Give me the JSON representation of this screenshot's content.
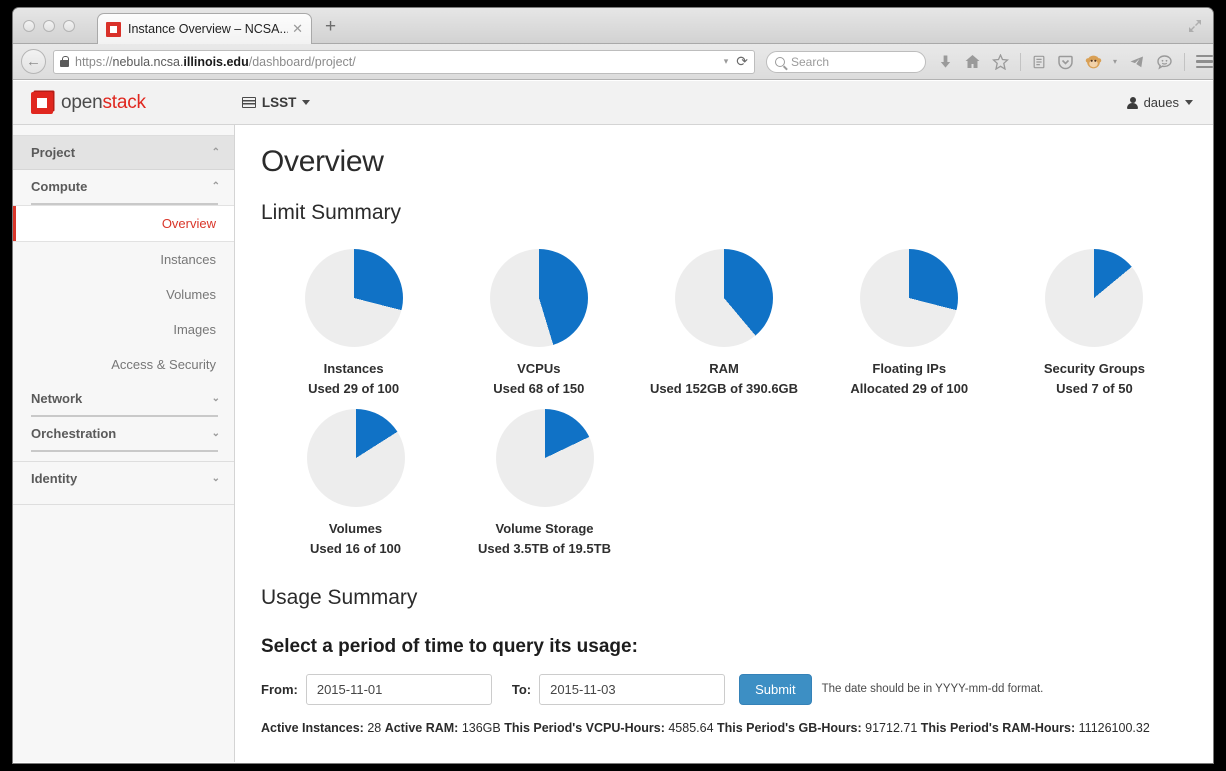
{
  "browser": {
    "tab": {
      "title": "Instance Overview – NCSA...",
      "close_label": "✕"
    },
    "new_tab_label": "+",
    "url": {
      "scheme": "https://",
      "subdomain": "nebula.ncsa.",
      "domain": "illinois.edu",
      "path": "/dashboard/project/"
    },
    "search_placeholder": "Search",
    "reload_label": "⟳",
    "caret_label": "▾"
  },
  "header": {
    "logo_open": "open",
    "logo_stack": "stack",
    "project": "LSST",
    "user": "daues"
  },
  "sidebar": {
    "groups": [
      {
        "label": "Project",
        "chevron": "⌃"
      },
      {
        "label": "Compute",
        "chevron": "⌃"
      },
      {
        "label": "Network",
        "chevron": "⌄"
      },
      {
        "label": "Orchestration",
        "chevron": "⌄"
      },
      {
        "label": "Identity",
        "chevron": "⌄"
      }
    ],
    "compute_items": [
      {
        "label": "Overview",
        "active": true
      },
      {
        "label": "Instances",
        "active": false
      },
      {
        "label": "Volumes",
        "active": false
      },
      {
        "label": "Images",
        "active": false
      },
      {
        "label": "Access & Security",
        "active": false
      }
    ]
  },
  "main": {
    "page_title": "Overview",
    "limit_summary_title": "Limit Summary",
    "usage_summary_title": "Usage Summary",
    "query_title": "Select a period of time to query its usage:",
    "form": {
      "from_label": "From:",
      "from_value": "2015-11-01",
      "to_label": "To:",
      "to_value": "2015-11-03",
      "submit_label": "Submit",
      "hint": "The date should be in YYYY-mm-dd format."
    },
    "stats": [
      {
        "label": "Active Instances:",
        "value": "28"
      },
      {
        "label": "Active RAM:",
        "value": "136GB"
      },
      {
        "label": "This Period's VCPU-Hours:",
        "value": "4585.64"
      },
      {
        "label": "This Period's GB-Hours:",
        "value": "91712.71"
      },
      {
        "label": "This Period's RAM-Hours:",
        "value": "11126100.32"
      }
    ]
  },
  "colors": {
    "pie_used": "#1072c6",
    "pie_free": "#ededed",
    "accent_red": "#d9362a",
    "submit_blue": "#3d8fc4"
  },
  "chart_data": [
    {
      "type": "pie",
      "title": "Instances",
      "subtitle": "Used 29 of 100",
      "categories": [
        "Used",
        "Available"
      ],
      "values": [
        29,
        71
      ],
      "unit": "instances",
      "used": 29,
      "total": 100,
      "percent": 29
    },
    {
      "type": "pie",
      "title": "VCPUs",
      "subtitle": "Used 68 of 150",
      "categories": [
        "Used",
        "Available"
      ],
      "values": [
        68,
        82
      ],
      "unit": "vcpus",
      "used": 68,
      "total": 150,
      "percent": 45.3
    },
    {
      "type": "pie",
      "title": "RAM",
      "subtitle": "Used 152GB of 390.6GB",
      "categories": [
        "Used",
        "Available"
      ],
      "values": [
        152,
        238.6
      ],
      "unit": "GB",
      "used": 152,
      "total": 390.6,
      "percent": 38.9
    },
    {
      "type": "pie",
      "title": "Floating IPs",
      "subtitle": "Allocated 29 of 100",
      "categories": [
        "Allocated",
        "Available"
      ],
      "values": [
        29,
        71
      ],
      "unit": "ips",
      "used": 29,
      "total": 100,
      "percent": 29
    },
    {
      "type": "pie",
      "title": "Security Groups",
      "subtitle": "Used 7 of 50",
      "categories": [
        "Used",
        "Available"
      ],
      "values": [
        7,
        43
      ],
      "unit": "groups",
      "used": 7,
      "total": 50,
      "percent": 14
    },
    {
      "type": "pie",
      "title": "Volumes",
      "subtitle": "Used 16 of 100",
      "categories": [
        "Used",
        "Available"
      ],
      "values": [
        16,
        84
      ],
      "unit": "volumes",
      "used": 16,
      "total": 100,
      "percent": 16
    },
    {
      "type": "pie",
      "title": "Volume Storage",
      "subtitle": "Used 3.5TB of 19.5TB",
      "categories": [
        "Used",
        "Available"
      ],
      "values": [
        3.5,
        16.0
      ],
      "unit": "TB",
      "used": 3.5,
      "total": 19.5,
      "percent": 17.9
    }
  ]
}
